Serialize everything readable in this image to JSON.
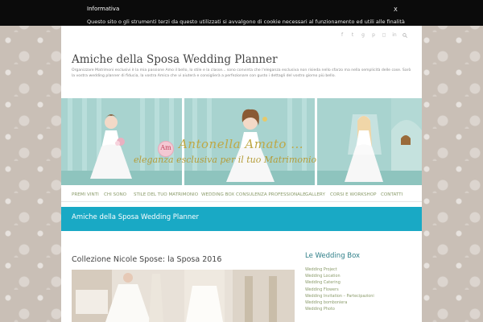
{
  "cookie_bar": {
    "title": "Informativa",
    "text": "Questo sito o gli strumenti terzi da questo utilizzati si avvalgono di cookie necessari al funzionamento ed utili alle finalità",
    "close_label": "X"
  },
  "header": {
    "social_icons": [
      "facebook-icon",
      "twitter-icon",
      "google-plus-icon",
      "pinterest-icon",
      "instagram-icon",
      "linkedin-icon",
      "search-icon"
    ],
    "site_title": "Amiche della Sposa Wedding Planner",
    "site_description": "Organizzare Matrimoni esclusivi è la mia passione Amo il bello, lo stile e la classe... sono convinta che l'eleganza esclusiva non risieda nello sfarzo ma nella semplicità delle cose. Sarò la vostra wedding planner di fiducia, la vostra Amica che vi aiuterà e consiglierà a perfezionare con gusto i dettagli del vostro giorno più bello."
  },
  "banner": {
    "logo_text": "Am",
    "title": "Antonella Amato ...",
    "subtitle": "eleganza esclusiva per il tuo Matrimonio",
    "colors": {
      "panel": "#a8d3cf",
      "panel_dark": "#8ec4be",
      "stripe": "#b8dcd8",
      "text": "#bfa845"
    }
  },
  "nav": {
    "items": [
      "PREMI VINTI",
      "CHI SONO",
      "STILE DEL TUO MATRIMONIO",
      "WEDDING BOX CONSULENZA PROFESSIONALE",
      "GALLERY",
      "CORSI E WORKSHOP",
      "CONTATTI"
    ]
  },
  "title_band": {
    "title": "Amiche della Sposa Wedding Planner",
    "color": "#19a9c5"
  },
  "post": {
    "title": "Collezione Nicole Spose: la Sposa 2016"
  },
  "sidebar": {
    "title": "Le Wedding Box",
    "items": [
      "Wedding Project",
      "Wedding Location",
      "Wedding Catering",
      "Wedding Flowers",
      "Wedding Invitation – Partecipazioni",
      "Wedding bomboniera",
      "Wedding Photo"
    ]
  }
}
